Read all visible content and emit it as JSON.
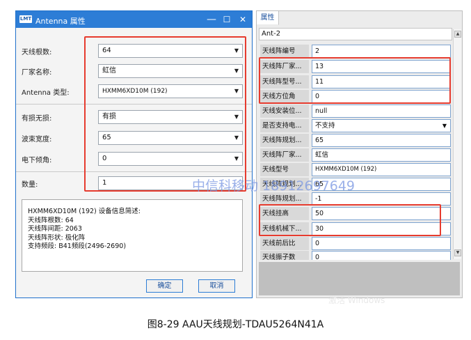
{
  "dialog": {
    "logo": "LMT",
    "title": "Antenna 属性",
    "win_minimize": "—",
    "win_maximize": "☐",
    "win_close": "✕",
    "fields": [
      {
        "label": "天线根数:",
        "value": "64"
      },
      {
        "label": "厂家名称:",
        "value": "虹信"
      },
      {
        "label": "Antenna 类型:",
        "value": "HXMM6XD10M (192)"
      },
      {
        "label": "有损无损:",
        "value": "有损"
      },
      {
        "label": "波束宽度:",
        "value": "65"
      },
      {
        "label": "电下倾角:",
        "value": "0"
      }
    ],
    "quantity": {
      "label": "数量:",
      "value": "1"
    },
    "description": {
      "lines": [
        "HXMM6XD10M (192) 设备信息简述:",
        "天线阵根数:  64",
        "天线阵间距:  2063",
        "天线阵形状:  极化阵",
        "支持频段:  B41频段(2496-2690)"
      ]
    },
    "ok_label": "确定",
    "cancel_label": "取消"
  },
  "props": {
    "tab_label": "属性",
    "object_name": "Ant-2",
    "rows": [
      {
        "name": "天线阵编号",
        "value": "2"
      },
      {
        "name": "天线阵厂家...",
        "value": "13"
      },
      {
        "name": "天线阵型号...",
        "value": "11"
      },
      {
        "name": "天线方位角",
        "value": "0"
      },
      {
        "name": "天线安装位...",
        "value": "null"
      },
      {
        "name": "是否支持电...",
        "value": "不支持"
      },
      {
        "name": "天线阵规划...",
        "value": "65"
      },
      {
        "name": "天线阵厂家...",
        "value": "虹信"
      },
      {
        "name": "天线型号",
        "value": "HXMM6XD10M (192)"
      },
      {
        "name": "天线阵规划...",
        "value": "65"
      },
      {
        "name": "天线阵规划...",
        "value": "-1"
      },
      {
        "name": "天线挂高",
        "value": "50"
      },
      {
        "name": "天线机械下...",
        "value": "30"
      },
      {
        "name": "天线前后比",
        "value": "0"
      },
      {
        "name": "天线振子数",
        "value": "0"
      }
    ],
    "activate_windows": "激活 Windows"
  },
  "watermark": "中信科移动 18912697649",
  "caption": "图8-29    AAU天线规划-TDAU5264N41A",
  "colors": {
    "highlight": "#e63b2e",
    "title_bar": "#2d7dd6",
    "watermark": "#7896e1"
  }
}
